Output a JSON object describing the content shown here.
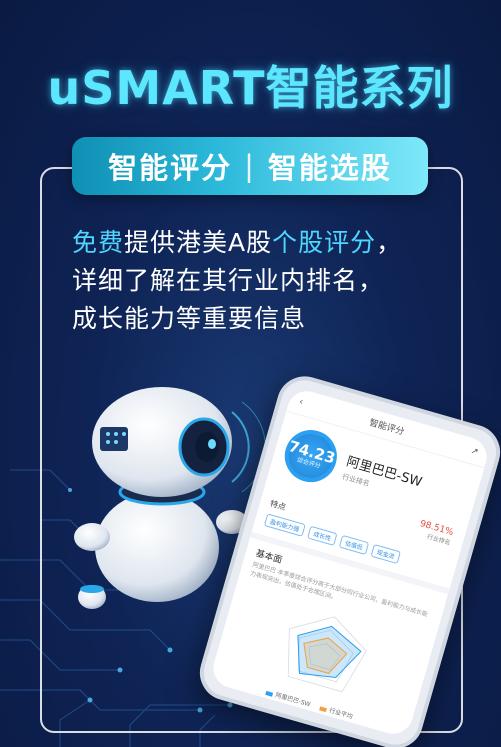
{
  "headline": "uSMART智能系列",
  "pill": {
    "left": "智能评分",
    "separator": "|",
    "right": "智能选股"
  },
  "description": {
    "line1_hl1": "免费",
    "line1_mid": "提供港美A股",
    "line1_hl2": "个股评分",
    "line1_end": "，",
    "line2": "详细了解在其行业内排名，",
    "line3": "成长能力等重要信息"
  },
  "phone": {
    "header_title": "智能评分",
    "score_value": "74.23",
    "score_label": "综合评分",
    "stock_name": "阿里巴巴-SW",
    "stock_sub": "行业排名",
    "percent": "98.51%",
    "percent_sub": "行业排名",
    "tags_label": "特点",
    "tags": [
      "盈利能力强",
      "成长性",
      "估值低",
      "现金流"
    ],
    "section_title": "基本面",
    "section_text": "阿里巴巴 本季度综合评分高于大部分同行业公司，盈利能力与成长能力表现突出，估值处于合理区间。",
    "legend": [
      "阿里巴巴-SW",
      "行业平均"
    ]
  },
  "colors": {
    "accent": "#5de7ff",
    "highlight": "#4fd6ff",
    "background": "#0f2456",
    "score_blue": "#2b9ff0",
    "percent_red": "#e84b3c"
  },
  "icons": [
    "robot-illustration",
    "back-arrow-icon",
    "close-icon",
    "share-icon",
    "circuit-background"
  ]
}
